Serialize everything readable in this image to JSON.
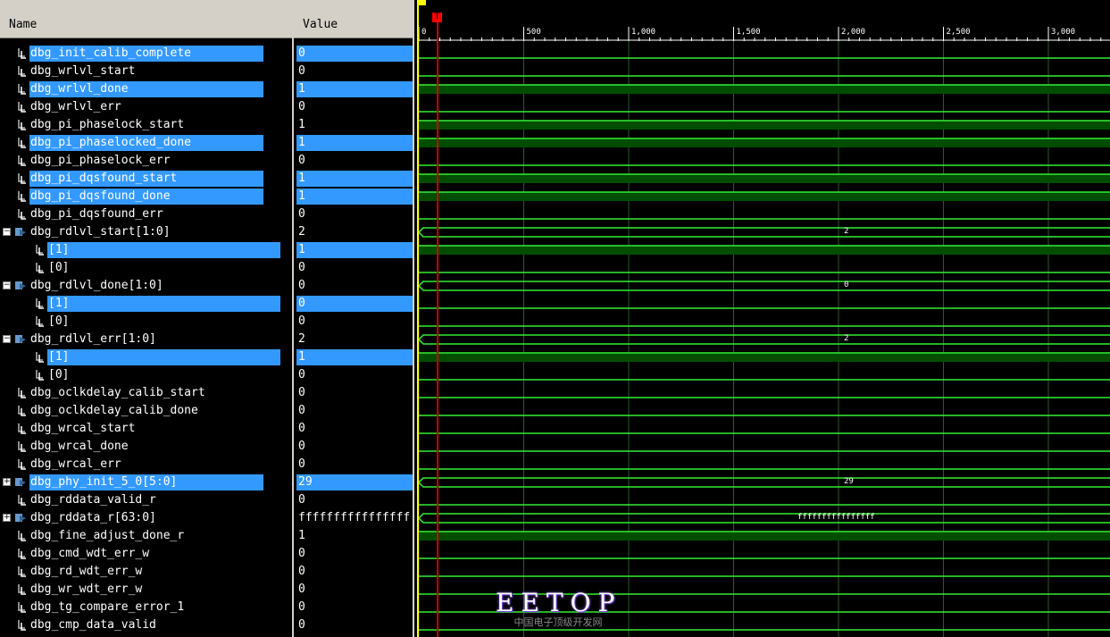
{
  "header": {
    "name_col": "Name",
    "value_col": "Value"
  },
  "ruler": {
    "origin": "0",
    "ticks": [
      "0",
      "500",
      "1,000",
      "1,500",
      "2,000",
      "2,500",
      "3,000"
    ],
    "cursor_label": "T"
  },
  "signals": [
    {
      "name": "dbg_init_calib_complete",
      "value": "0",
      "indent": 0,
      "kind": "bit",
      "selected": true,
      "level": 0
    },
    {
      "name": "dbg_wrlvl_start",
      "value": "0",
      "indent": 0,
      "kind": "bit",
      "selected": false,
      "level": 0
    },
    {
      "name": "dbg_wrlvl_done",
      "value": "1",
      "indent": 0,
      "kind": "bit",
      "selected": true,
      "level": 1
    },
    {
      "name": "dbg_wrlvl_err",
      "value": "0",
      "indent": 0,
      "kind": "bit",
      "selected": false,
      "level": 0
    },
    {
      "name": "dbg_pi_phaselock_start",
      "value": "1",
      "indent": 0,
      "kind": "bit",
      "selected": false,
      "level": 1
    },
    {
      "name": "dbg_pi_phaselocked_done",
      "value": "1",
      "indent": 0,
      "kind": "bit",
      "selected": true,
      "level": 1
    },
    {
      "name": "dbg_pi_phaselock_err",
      "value": "0",
      "indent": 0,
      "kind": "bit",
      "selected": false,
      "level": 0
    },
    {
      "name": "dbg_pi_dqsfound_start",
      "value": "1",
      "indent": 0,
      "kind": "bit",
      "selected": true,
      "level": 1
    },
    {
      "name": "dbg_pi_dqsfound_done",
      "value": "1",
      "indent": 0,
      "kind": "bit",
      "selected": true,
      "level": 1
    },
    {
      "name": "dbg_pi_dqsfound_err",
      "value": "0",
      "indent": 0,
      "kind": "bit",
      "selected": false,
      "level": 0
    },
    {
      "name": "dbg_rdlvl_start[1:0]",
      "value": "2",
      "indent": 0,
      "kind": "bus",
      "expanded": true,
      "selected": false,
      "bus_label": "2"
    },
    {
      "name": "[1]",
      "value": "1",
      "indent": 1,
      "kind": "bit",
      "selected": true,
      "level": 1
    },
    {
      "name": "[0]",
      "value": "0",
      "indent": 1,
      "kind": "bit",
      "selected": false,
      "level": 0
    },
    {
      "name": "dbg_rdlvl_done[1:0]",
      "value": "0",
      "indent": 0,
      "kind": "bus",
      "expanded": true,
      "selected": false,
      "bus_label": "0"
    },
    {
      "name": "[1]",
      "value": "0",
      "indent": 1,
      "kind": "bit",
      "selected": true,
      "level": 0
    },
    {
      "name": "[0]",
      "value": "0",
      "indent": 1,
      "kind": "bit",
      "selected": false,
      "level": 0
    },
    {
      "name": "dbg_rdlvl_err[1:0]",
      "value": "2",
      "indent": 0,
      "kind": "bus",
      "expanded": true,
      "selected": false,
      "bus_label": "2"
    },
    {
      "name": "[1]",
      "value": "1",
      "indent": 1,
      "kind": "bit",
      "selected": true,
      "level": 1
    },
    {
      "name": "[0]",
      "value": "0",
      "indent": 1,
      "kind": "bit",
      "selected": false,
      "level": 0
    },
    {
      "name": "dbg_oclkdelay_calib_start",
      "value": "0",
      "indent": 0,
      "kind": "bit",
      "selected": false,
      "level": 0
    },
    {
      "name": "dbg_oclkdelay_calib_done",
      "value": "0",
      "indent": 0,
      "kind": "bit",
      "selected": false,
      "level": 0
    },
    {
      "name": "dbg_wrcal_start",
      "value": "0",
      "indent": 0,
      "kind": "bit",
      "selected": false,
      "level": 0
    },
    {
      "name": "dbg_wrcal_done",
      "value": "0",
      "indent": 0,
      "kind": "bit",
      "selected": false,
      "level": 0
    },
    {
      "name": "dbg_wrcal_err",
      "value": "0",
      "indent": 0,
      "kind": "bit",
      "selected": false,
      "level": 0
    },
    {
      "name": "dbg_phy_init_5_0[5:0]",
      "value": "29",
      "indent": 0,
      "kind": "bus",
      "expanded": false,
      "selected": true,
      "bus_label": "29"
    },
    {
      "name": "dbg_rddata_valid_r",
      "value": "0",
      "indent": 0,
      "kind": "bit",
      "selected": false,
      "level": 0
    },
    {
      "name": "dbg_rddata_r[63:0]",
      "value": "ffffffffffffffff",
      "indent": 0,
      "kind": "bus",
      "expanded": false,
      "selected": false,
      "bus_label": "ffffffffffffffff"
    },
    {
      "name": "dbg_fine_adjust_done_r",
      "value": "1",
      "indent": 0,
      "kind": "bit",
      "selected": false,
      "level": 1
    },
    {
      "name": "dbg_cmd_wdt_err_w",
      "value": "0",
      "indent": 0,
      "kind": "bit",
      "selected": false,
      "level": 0
    },
    {
      "name": "dbg_rd_wdt_err_w",
      "value": "0",
      "indent": 0,
      "kind": "bit",
      "selected": false,
      "level": 0
    },
    {
      "name": "dbg_wr_wdt_err_w",
      "value": "0",
      "indent": 0,
      "kind": "bit",
      "selected": false,
      "level": 0
    },
    {
      "name": "dbg_tg_compare_error_1",
      "value": "0",
      "indent": 0,
      "kind": "bit",
      "selected": false,
      "level": 0
    },
    {
      "name": "dbg_cmp_data_valid",
      "value": "0",
      "indent": 0,
      "kind": "bit",
      "selected": false,
      "level": 0
    }
  ],
  "watermark": {
    "brand": "EETOP",
    "subtitle": "中国电子顶级开发网"
  },
  "colors": {
    "selection": "#3399ff",
    "wave_green": "#33ee33",
    "high_fill": "#004d00",
    "cursor": "#cc0000",
    "panel_gray": "#d4d0c8"
  }
}
